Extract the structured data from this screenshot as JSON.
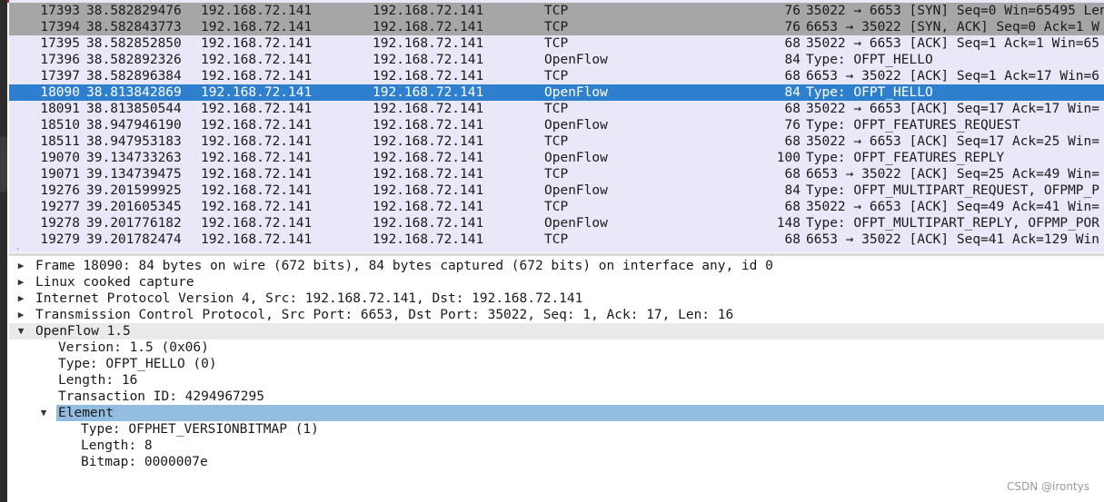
{
  "packets": [
    {
      "no": "17393",
      "time": "38.582829476",
      "src": "192.168.72.141",
      "dst": "192.168.72.141",
      "proto": "TCP",
      "len": "76",
      "info": "35022 → 6653 [SYN] Seq=0 Win=65495 Len",
      "style": "gray"
    },
    {
      "no": "17394",
      "time": "38.582843773",
      "src": "192.168.72.141",
      "dst": "192.168.72.141",
      "proto": "TCP",
      "len": "76",
      "info": "6653 → 35022 [SYN, ACK] Seq=0 Ack=1 W",
      "style": "gray"
    },
    {
      "no": "17395",
      "time": "38.582852850",
      "src": "192.168.72.141",
      "dst": "192.168.72.141",
      "proto": "TCP",
      "len": "68",
      "info": "35022 → 6653 [ACK] Seq=1 Ack=1 Win=65",
      "style": "normal"
    },
    {
      "no": "17396",
      "time": "38.582892326",
      "src": "192.168.72.141",
      "dst": "192.168.72.141",
      "proto": "OpenFlow",
      "len": "84",
      "info": "Type: OFPT_HELLO",
      "style": "normal"
    },
    {
      "no": "17397",
      "time": "38.582896384",
      "src": "192.168.72.141",
      "dst": "192.168.72.141",
      "proto": "TCP",
      "len": "68",
      "info": "6653 → 35022 [ACK] Seq=1 Ack=17 Win=6",
      "style": "normal"
    },
    {
      "no": "18090",
      "time": "38.813842869",
      "src": "192.168.72.141",
      "dst": "192.168.72.141",
      "proto": "OpenFlow",
      "len": "84",
      "info": "Type: OFPT_HELLO",
      "style": "selected"
    },
    {
      "no": "18091",
      "time": "38.813850544",
      "src": "192.168.72.141",
      "dst": "192.168.72.141",
      "proto": "TCP",
      "len": "68",
      "info": "35022 → 6653 [ACK] Seq=17 Ack=17 Win=",
      "style": "normal"
    },
    {
      "no": "18510",
      "time": "38.947946190",
      "src": "192.168.72.141",
      "dst": "192.168.72.141",
      "proto": "OpenFlow",
      "len": "76",
      "info": "Type: OFPT_FEATURES_REQUEST",
      "style": "normal"
    },
    {
      "no": "18511",
      "time": "38.947953183",
      "src": "192.168.72.141",
      "dst": "192.168.72.141",
      "proto": "TCP",
      "len": "68",
      "info": "35022 → 6653 [ACK] Seq=17 Ack=25 Win=",
      "style": "normal"
    },
    {
      "no": "19070",
      "time": "39.134733263",
      "src": "192.168.72.141",
      "dst": "192.168.72.141",
      "proto": "OpenFlow",
      "len": "100",
      "info": "Type: OFPT_FEATURES_REPLY",
      "style": "normal"
    },
    {
      "no": "19071",
      "time": "39.134739475",
      "src": "192.168.72.141",
      "dst": "192.168.72.141",
      "proto": "TCP",
      "len": "68",
      "info": "6653 → 35022 [ACK] Seq=25 Ack=49 Win=",
      "style": "normal"
    },
    {
      "no": "19276",
      "time": "39.201599925",
      "src": "192.168.72.141",
      "dst": "192.168.72.141",
      "proto": "OpenFlow",
      "len": "84",
      "info": "Type: OFPT_MULTIPART_REQUEST, OFPMP_P",
      "style": "normal"
    },
    {
      "no": "19277",
      "time": "39.201605345",
      "src": "192.168.72.141",
      "dst": "192.168.72.141",
      "proto": "TCP",
      "len": "68",
      "info": "35022 → 6653 [ACK] Seq=49 Ack=41 Win=",
      "style": "normal"
    },
    {
      "no": "19278",
      "time": "39.201776182",
      "src": "192.168.72.141",
      "dst": "192.168.72.141",
      "proto": "OpenFlow",
      "len": "148",
      "info": "Type: OFPT_MULTIPART_REPLY, OFPMP_POR",
      "style": "normal"
    },
    {
      "no": "19279",
      "time": "39.201782474",
      "src": "192.168.72.141",
      "dst": "192.168.72.141",
      "proto": "TCP",
      "len": "68",
      "info": "6653 → 35022 [ACK] Seq=41 Ack=129 Win",
      "style": "normal"
    }
  ],
  "details": [
    {
      "indent": 0,
      "arrow": "right",
      "text": "Frame 18090: 84 bytes on wire (672 bits), 84 bytes captured (672 bits) on interface any, id 0",
      "style": "normal"
    },
    {
      "indent": 0,
      "arrow": "right",
      "text": "Linux cooked capture",
      "style": "normal"
    },
    {
      "indent": 0,
      "arrow": "right",
      "text": "Internet Protocol Version 4, Src: 192.168.72.141, Dst: 192.168.72.141",
      "style": "normal"
    },
    {
      "indent": 0,
      "arrow": "right",
      "text": "Transmission Control Protocol, Src Port: 6653, Dst Port: 35022, Seq: 1, Ack: 17, Len: 16",
      "style": "normal"
    },
    {
      "indent": 0,
      "arrow": "down",
      "text": "OpenFlow 1.5",
      "style": "highlight"
    },
    {
      "indent": 1,
      "arrow": "",
      "text": "Version: 1.5 (0x06)",
      "style": "normal"
    },
    {
      "indent": 1,
      "arrow": "",
      "text": "Type: OFPT_HELLO (0)",
      "style": "normal"
    },
    {
      "indent": 1,
      "arrow": "",
      "text": "Length: 16",
      "style": "normal"
    },
    {
      "indent": 1,
      "arrow": "",
      "text": "Transaction ID: 4294967295",
      "style": "normal"
    },
    {
      "indent": 1,
      "arrow": "down",
      "text": "Element",
      "style": "selected"
    },
    {
      "indent": 2,
      "arrow": "",
      "text": "Type: OFPHET_VERSIONBITMAP (1)",
      "style": "normal"
    },
    {
      "indent": 2,
      "arrow": "",
      "text": "Length: 8",
      "style": "normal"
    },
    {
      "indent": 2,
      "arrow": "",
      "text": "Bitmap: 0000007e",
      "style": "normal"
    }
  ],
  "watermark": "CSDN @irontys",
  "colors": {
    "selected_row": "#2f7fcf",
    "gray_row": "#a6a6a6",
    "list_bg": "#e8e8f8",
    "element_selected": "#93bde0"
  },
  "icons": {
    "collapsed": "triangle-right-icon",
    "expanded": "triangle-down-icon"
  }
}
